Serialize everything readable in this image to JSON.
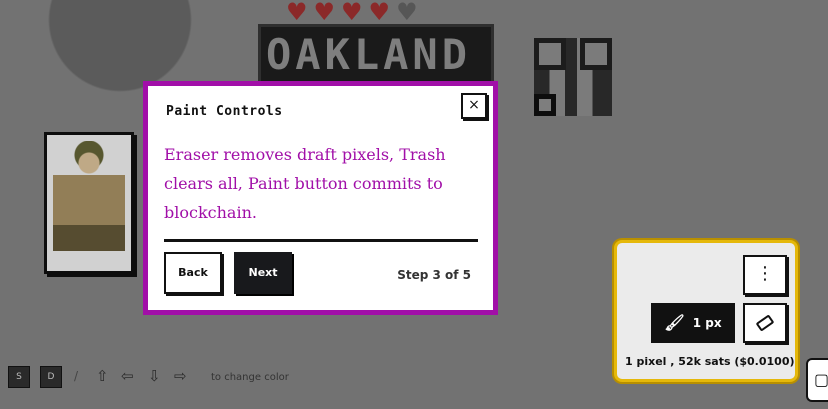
{
  "modal": {
    "title": "Paint Controls",
    "close_label": "×",
    "body": "Eraser removes draft pixels, Trash clears all, Paint button commits to blockchain.",
    "back_label": "Back",
    "next_label": "Next",
    "step": "Step 3 of 5"
  },
  "paint_panel": {
    "menu_label": "⋮",
    "brush_icon": "paintbrush-icon",
    "paint_label": "1 px",
    "eraser_icon": "eraser-icon",
    "cost": "1 pixel , 52k sats ($0.0100)"
  },
  "hint": {
    "keys": [
      "S",
      "D"
    ],
    "separator": "/",
    "arrows": [
      "⇧",
      "⇦",
      "⇩",
      "⇨"
    ],
    "text": "to change color"
  },
  "canvas": {
    "banner_text": "OAKLAND",
    "hearts_full": 4,
    "hearts_total": 5
  },
  "colors": {
    "accent": "#a10fa8",
    "panel_border": "#e5b80a",
    "primary_button": "#18191c"
  }
}
